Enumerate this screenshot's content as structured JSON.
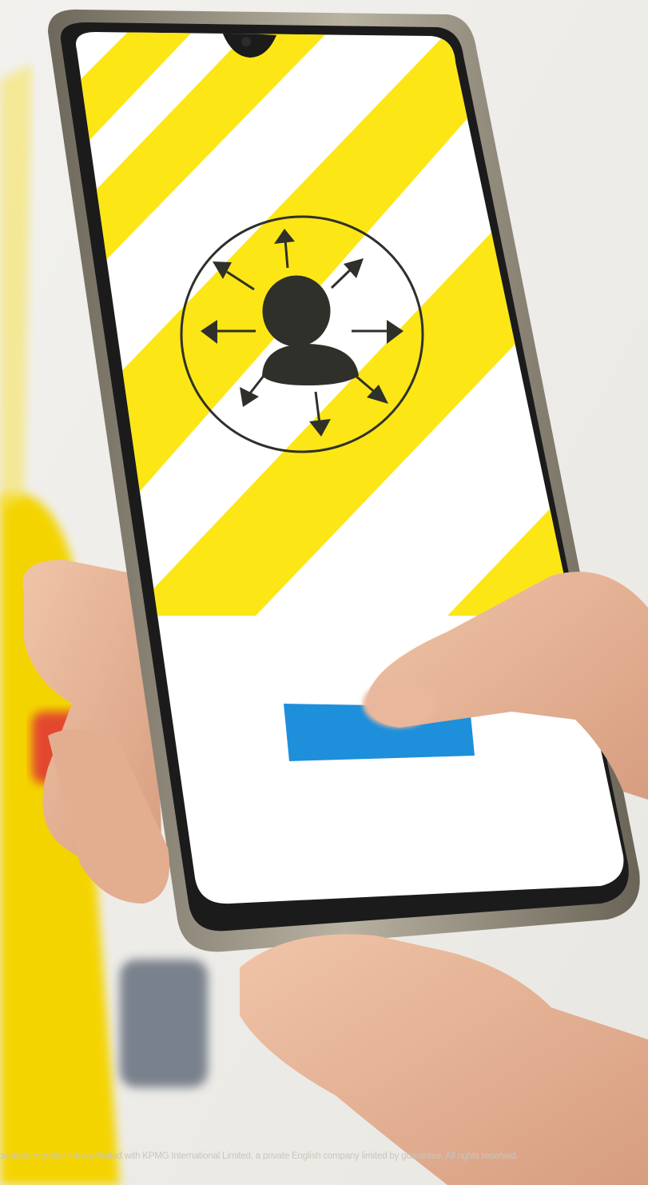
{
  "footer": {
    "legal_text": "pendent member firms affiliated with KPMG International Limited, a private English company limited by guarantee. All rights reserved."
  },
  "colors": {
    "stripe_yellow": "#fce616",
    "stripe_white": "#ffffff",
    "button_blue": "#1e8fda",
    "icon_dark": "#2f302a",
    "phone_frame": "#8a857a",
    "skin": "#e6b59a"
  },
  "phone_screen": {
    "icon": "person-with-outward-arrows-icon",
    "button": "blue-button"
  }
}
